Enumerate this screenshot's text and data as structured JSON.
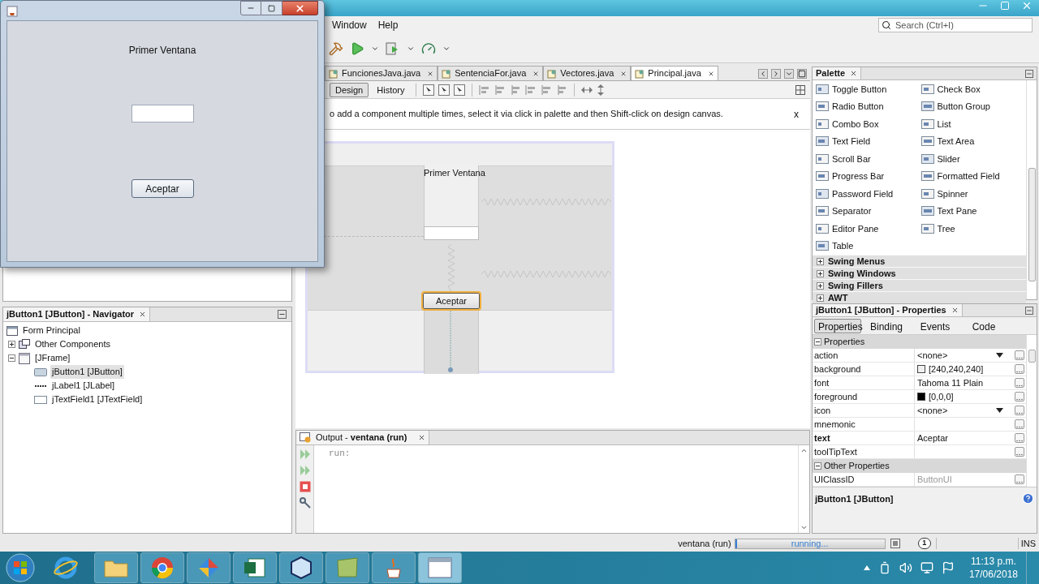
{
  "java_window": {
    "label": "Primer Ventana",
    "button": "Aceptar"
  },
  "menu": [
    "Window",
    "Help"
  ],
  "search": {
    "placeholder": "Search (Ctrl+I)"
  },
  "editor_tabs": [
    {
      "label": "FuncionesJava.java",
      "selected": false
    },
    {
      "label": "SentenciaFor.java",
      "selected": false
    },
    {
      "label": "Vectores.java",
      "selected": false
    },
    {
      "label": "Principal.java",
      "selected": true
    }
  ],
  "design_modes": [
    {
      "label": "Design",
      "selected": true
    },
    {
      "label": "History",
      "selected": false
    }
  ],
  "hint": {
    "text": "o add a component multiple times, select it via click in palette and then Shift-click on design canvas.",
    "close": "x"
  },
  "form": {
    "label": "Primer Ventana",
    "button": "Aceptar"
  },
  "navigator": {
    "title": "jButton1 [JButton] - Navigator",
    "tree": [
      {
        "label": "Form Principal",
        "kind": "form",
        "children": [
          {
            "label": "Other Components",
            "kind": "group",
            "expanded": false,
            "selected": false
          },
          {
            "label": "[JFrame]",
            "kind": "frame",
            "expanded": true,
            "selected": false,
            "children": [
              {
                "label": "jButton1 [JButton]",
                "kind": "button",
                "selected": true
              },
              {
                "label": "jLabel1 [JLabel]",
                "kind": "label",
                "selected": false
              },
              {
                "label": "jTextField1 [JTextField]",
                "kind": "field",
                "selected": false
              }
            ]
          }
        ]
      }
    ]
  },
  "output": {
    "title": "Output - **ventana (run)**",
    "lines": [
      "run:"
    ]
  },
  "palette": {
    "title": "Palette",
    "items": [
      "Toggle Button",
      "Check Box",
      "Radio Button",
      "Button Group",
      "Combo Box",
      "List",
      "Text Field",
      "Text Area",
      "Scroll Bar",
      "Slider",
      "Progress Bar",
      "Formatted Field",
      "Password Field",
      "Spinner",
      "Separator",
      "Text Pane",
      "Editor Pane",
      "Tree",
      "Table"
    ],
    "categories": [
      {
        "label": "Swing Menus",
        "expanded": false
      },
      {
        "label": "Swing Windows",
        "expanded": false
      },
      {
        "label": "Swing Fillers",
        "expanded": false
      },
      {
        "label": "AWT",
        "expanded": false
      }
    ]
  },
  "properties": {
    "title": "jButton1 [JButton] - Properties",
    "tabs": [
      {
        "label": "Properties",
        "selected": true
      },
      {
        "label": "Binding",
        "selected": false
      },
      {
        "label": "Events",
        "selected": false
      },
      {
        "label": "Code",
        "selected": false
      }
    ],
    "groups": [
      {
        "label": "Properties",
        "expanded": true,
        "rows": [
          {
            "name": "action",
            "value": "<none>",
            "kind": "dropdown",
            "modified": false
          },
          {
            "name": "background",
            "value": "[240,240,240]",
            "kind": "color",
            "color": "#f0f0f0",
            "modified": false
          },
          {
            "name": "font",
            "value": "Tahoma 11 Plain",
            "kind": "text",
            "modified": false
          },
          {
            "name": "foreground",
            "value": "[0,0,0]",
            "kind": "color",
            "color": "#000000",
            "modified": false
          },
          {
            "name": "icon",
            "value": "<none>",
            "kind": "dropdown",
            "modified": false
          },
          {
            "name": "mnemonic",
            "kind": "text",
            "modified": false
          },
          {
            "name": "text",
            "value": "Aceptar",
            "kind": "text",
            "modified": true
          },
          {
            "name": "toolTipText",
            "kind": "text",
            "modified": false
          }
        ]
      },
      {
        "label": "Other Properties",
        "expanded": true,
        "rows": [
          {
            "name": "UIClassID",
            "value": "ButtonUI",
            "kind": "readonly",
            "modified": false
          }
        ]
      }
    ],
    "footer": "jButton1 [JButton]"
  },
  "status_bar": {
    "task": "ventana (run)",
    "progress": "running...",
    "level": 0.01,
    "notifications": "1",
    "mode": "INS"
  },
  "taskbar": {
    "time": "11:13 p.m.",
    "date": "17/06/2018"
  }
}
